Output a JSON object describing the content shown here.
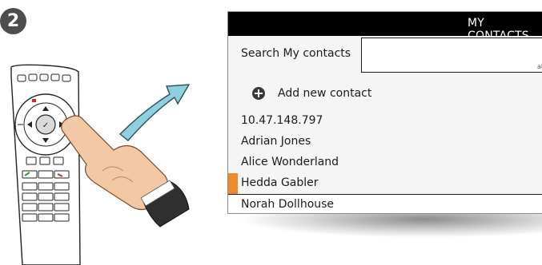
{
  "step_number": "2",
  "panel": {
    "title": "MY CONTACTS",
    "search": {
      "label": "Search My contacts",
      "value": "",
      "hint": "ab"
    },
    "add_contact_label": "Add new contact",
    "contacts": [
      {
        "name": "10.47.148.797"
      },
      {
        "name": "Adrian Jones"
      },
      {
        "name": "Alice Wonderland"
      },
      {
        "name": "Hedda Gabler",
        "selected": true
      },
      {
        "name": "Norah Dollhouse"
      }
    ]
  },
  "colors": {
    "header_bg": "#000000",
    "selection_marker": "#ec8a2c",
    "arrow_fill": "#8fd0de"
  },
  "icons": [
    "step-number-badge",
    "remote-control",
    "pointing-hand",
    "direction-arrow",
    "add-contact-icon"
  ]
}
